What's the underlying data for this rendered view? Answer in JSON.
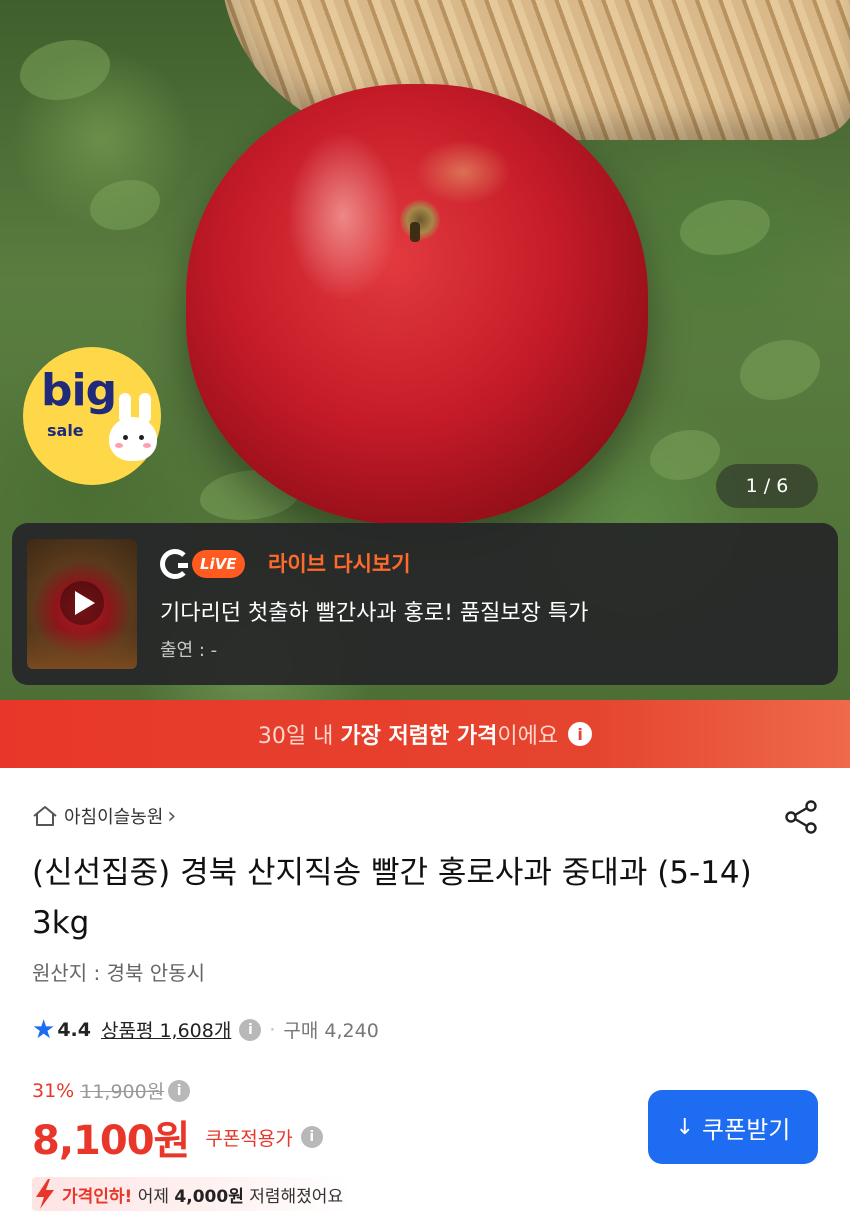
{
  "hero": {
    "badge_big": "big",
    "badge_sale": "sale",
    "image_counter": "1 / 6"
  },
  "live": {
    "brand_letter": "G",
    "brand_pill": "LiVE",
    "replay_label": "라이브 다시보기",
    "title": "기다리던 첫출하 빨간사과 홍로! 품질보장 특가",
    "host": "출연 : -"
  },
  "banner": {
    "prefix": "30일 내 ",
    "highlight": "가장 저렴한 가격",
    "suffix": "이에요",
    "info_glyph": "i"
  },
  "product": {
    "seller": "아침이슬농원",
    "seller_chevron": "›",
    "title": "(신선집중) 경북 산지직송 빨간 홍로사과 중대과 (5-14) 3kg",
    "origin": "원산지 : 경북 안동시",
    "rating_star": "★",
    "rating": "4.4",
    "review_link": "상품평 1,608개",
    "info_glyph": "i",
    "separator": "·",
    "purchase_count": "구매 4,240"
  },
  "pricing": {
    "discount": "31%",
    "original_price": "11,900원",
    "price": "8,100원",
    "coupon_note": "쿠폰적용가",
    "coupon_button": "쿠폰받기",
    "download_glyph": "↓",
    "drop_highlight": "가격인하!",
    "drop_prefix": " 어제 ",
    "drop_amount": "4,000원",
    "drop_suffix": " 저렴해졌어요"
  },
  "colors": {
    "accent_red": "#e8372a",
    "accent_blue": "#1d6cf2",
    "live_orange": "#ff5a1f"
  }
}
